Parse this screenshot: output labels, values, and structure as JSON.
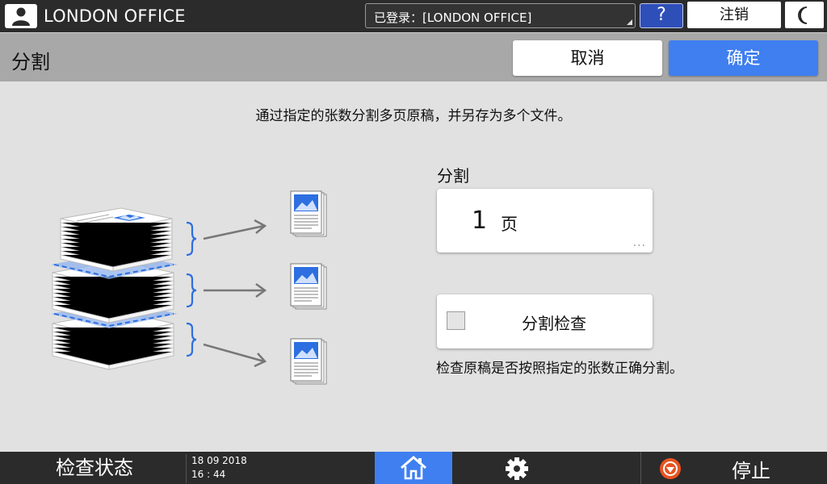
{
  "topbar": {
    "user_name": "LONDON OFFICE",
    "login_status": "已登录：[LONDON OFFICE]",
    "help_label": "?",
    "logout_label": "注销"
  },
  "header": {
    "title": "分割",
    "cancel_label": "取消",
    "ok_label": "确定"
  },
  "main": {
    "description": "通过指定的张数分割多页原稿，并另存为多个文件。",
    "split_label": "分割",
    "pages_value": "1",
    "pages_unit": "页",
    "pages_more": "...",
    "split_check_label": "分割检查",
    "split_check_checked": false,
    "split_check_description": "检查原稿是否按照指定的张数正确分割。"
  },
  "bottombar": {
    "status_label": "检查状态",
    "date": "18 09 2018",
    "time": "16 : 44",
    "stop_label": "停止"
  },
  "colors": {
    "accent_blue": "#3f7ff0",
    "help_blue": "#2f4fb8",
    "stop_orange": "#e8541f",
    "bar_dark": "#2b2b2b",
    "header_gray": "#a8a8a8",
    "content_gray": "#e1e1e1"
  },
  "icons": {
    "user": "user-icon",
    "moon": "moon-icon",
    "home": "home-icon",
    "settings": "gear-icon",
    "stop": "stop-icon"
  }
}
